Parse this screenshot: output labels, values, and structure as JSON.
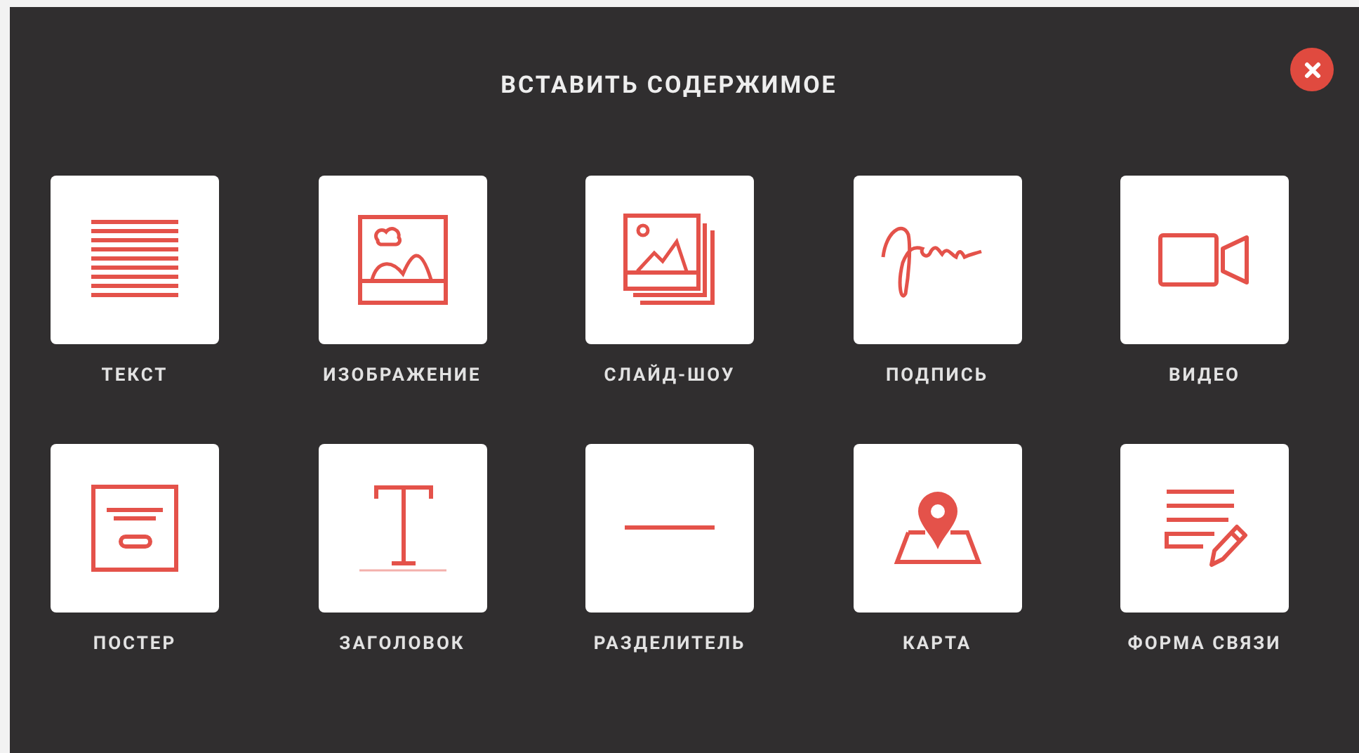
{
  "dialog": {
    "title": "ВСТАВИТЬ СОДЕРЖИМОЕ"
  },
  "items": [
    {
      "kind": "text",
      "label": "ТЕКСТ"
    },
    {
      "kind": "image",
      "label": "ИЗОБРАЖЕНИЕ"
    },
    {
      "kind": "slideshow",
      "label": "СЛАЙД-ШОУ"
    },
    {
      "kind": "signature",
      "label": "ПОДПИСЬ"
    },
    {
      "kind": "video",
      "label": "ВИДЕО"
    },
    {
      "kind": "poster",
      "label": "ПОСТЕР"
    },
    {
      "kind": "heading",
      "label": "ЗАГОЛОВОК"
    },
    {
      "kind": "divider",
      "label": "РАЗДЕЛИТЕЛЬ"
    },
    {
      "kind": "map",
      "label": "КАРТА"
    },
    {
      "kind": "form",
      "label": "ФОРМА СВЯЗИ"
    }
  ]
}
